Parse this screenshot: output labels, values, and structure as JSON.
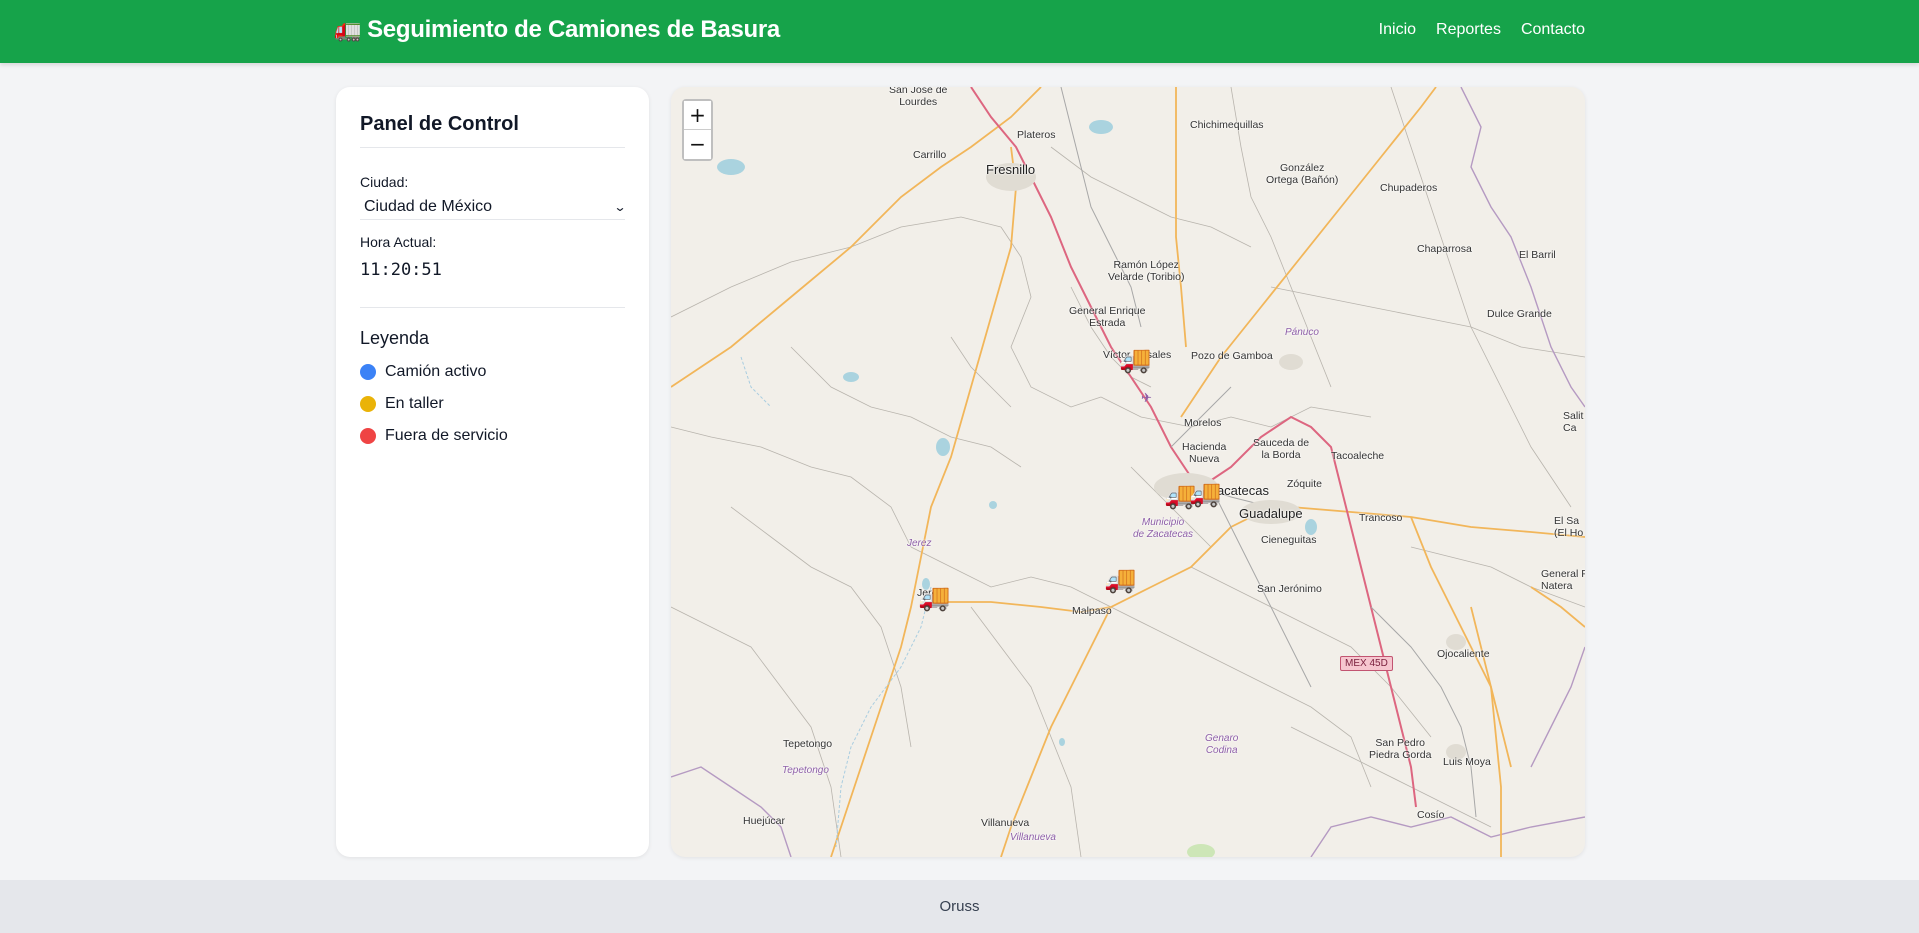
{
  "header": {
    "icon": "🚛",
    "title": "Seguimiento de Camiones de Basura",
    "nav": [
      "Inicio",
      "Reportes",
      "Contacto"
    ]
  },
  "panel": {
    "title": "Panel de Control",
    "city_label": "Ciudad:",
    "city_value": "Ciudad de México",
    "time_label": "Hora Actual:",
    "time_value": "11:20:51",
    "legend_title": "Leyenda",
    "legend": [
      {
        "label": "Camión activo",
        "color": "#3b82f6"
      },
      {
        "label": "En taller",
        "color": "#eab308"
      },
      {
        "label": "Fuera de servicio",
        "color": "#ef4444"
      }
    ]
  },
  "map": {
    "zoom_in": "+",
    "zoom_out": "−",
    "truck_icon": "🚚",
    "places": {
      "fresnillo": "Fresnillo",
      "zacatecas": "Zacatecas",
      "guadalupe": "Guadalupe",
      "sanjose": "San José de\nLourdes",
      "plateros": "Plateros",
      "carrillo": "Carrillo",
      "chichimequillas": "Chichimequillas",
      "gonzalez": "González\nOrtega (Bañón)",
      "chupaderos": "Chupaderos",
      "chaparrosa": "Chaparrosa",
      "elbarril": "El Barril",
      "dulcegrande": "Dulce Grande",
      "ramonlopez": "Ramón López\nVelarde (Toribio)",
      "generalenrique": "General Enrique\nEstrada",
      "victor": "Víctor Rosales",
      "pozo": "Pozo de Gamboa",
      "panuco": "Pánuco",
      "morelos": "Morelos",
      "hacienda": "Hacienda\nNueva",
      "sauceda": "Sauceda de\nla Borda",
      "tacoaleche": "Tacoaleche",
      "zoquite": "Zóquite",
      "trancoso": "Trancoso",
      "municipio": "Municipio\nde Zacatecas",
      "cieneguitas": "Cieneguitas",
      "jerezmuni": "Jerez",
      "jerez": "Jerez",
      "malpaso": "Malpaso",
      "sanjeronimo": "San Jerónimo",
      "ojocaliente": "Ojocaliente",
      "generalpanfilo": "General Pá\nNatera",
      "elsalvador": "El Sa\n(El Ho",
      "salit": "Salit\nCa",
      "tepetongo": "Tepetongo",
      "tepetongomuni": "Tepetongo",
      "genaro": "Genaro\nCodina",
      "sanpedro": "San Pedro\nPiedra Gorda",
      "luismoya": "Luis Moya",
      "cosio": "Cosío",
      "huejucar": "Huejúcar",
      "villanueva": "Villanueva",
      "villanuevamuni": "Villanueva",
      "mex45d": "MEX 45D"
    }
  },
  "footer": {
    "text": "Oruss"
  }
}
